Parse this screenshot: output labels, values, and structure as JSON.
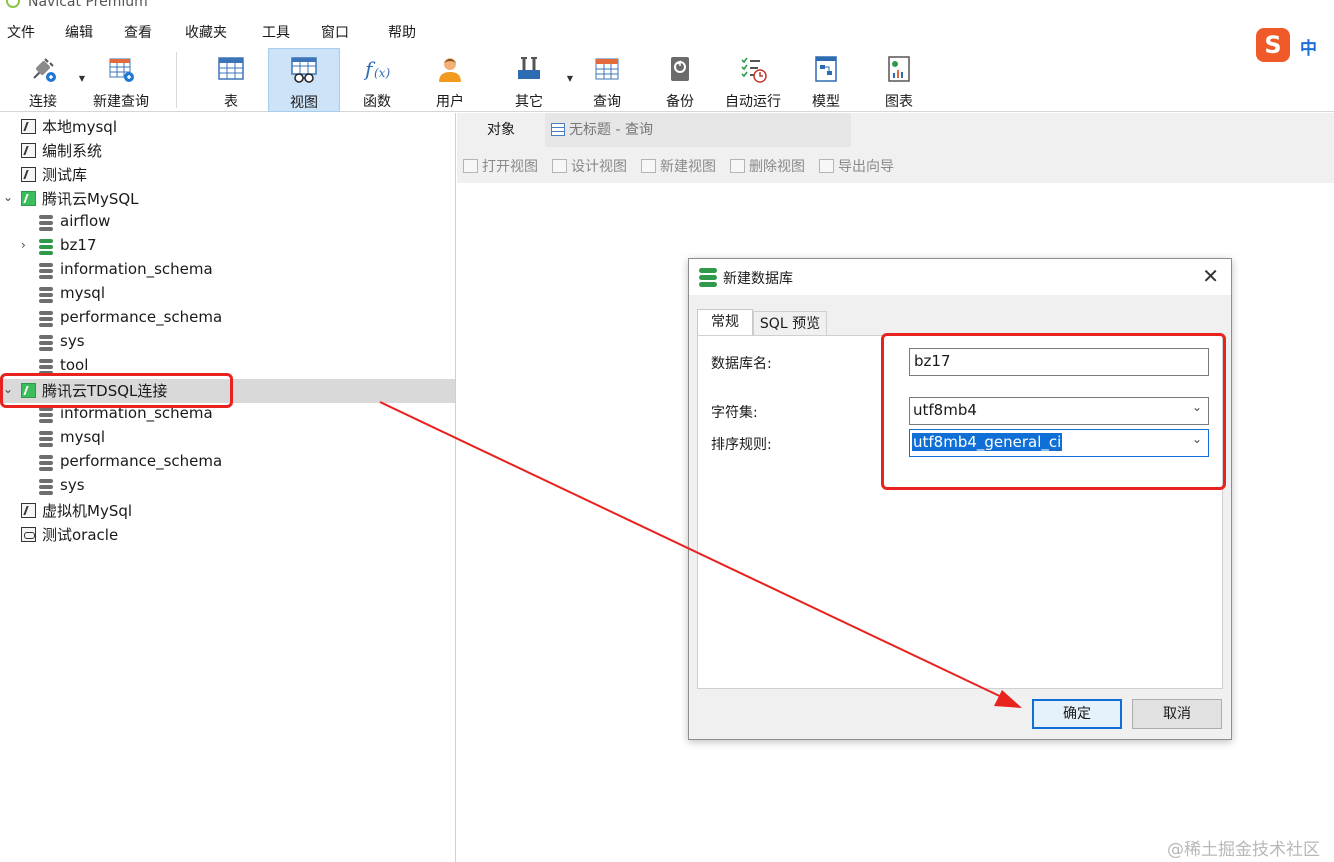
{
  "app": {
    "title": "Navicat Premium"
  },
  "menu": [
    "文件",
    "编辑",
    "查看",
    "收藏夹",
    "工具",
    "窗口",
    "帮助"
  ],
  "ime": {
    "logo": "S",
    "mode": "中"
  },
  "toolbar": {
    "connect": "连接",
    "new_query": "新建查询",
    "table": "表",
    "view": "视图",
    "function": "函数",
    "user": "用户",
    "other": "其它",
    "query": "查询",
    "backup": "备份",
    "auto_run": "自动运行",
    "model": "模型",
    "chart": "图表"
  },
  "tree": [
    {
      "label": "本地mysql",
      "kind": "connection"
    },
    {
      "label": "编制系统",
      "kind": "connection"
    },
    {
      "label": "测试库",
      "kind": "connection"
    },
    {
      "label": "腾讯云MySQL",
      "kind": "connection-open"
    },
    {
      "label": "airflow",
      "kind": "database"
    },
    {
      "label": "bz17",
      "kind": "database-open"
    },
    {
      "label": "information_schema",
      "kind": "database"
    },
    {
      "label": "mysql",
      "kind": "database"
    },
    {
      "label": "performance_schema",
      "kind": "database"
    },
    {
      "label": "sys",
      "kind": "database"
    },
    {
      "label": "tool",
      "kind": "database"
    },
    {
      "label": "腾讯云TDSQL连接",
      "kind": "connection-open",
      "selected": true
    },
    {
      "label": "information_schema",
      "kind": "database"
    },
    {
      "label": "mysql",
      "kind": "database"
    },
    {
      "label": "performance_schema",
      "kind": "database"
    },
    {
      "label": "sys",
      "kind": "database"
    },
    {
      "label": "虚拟机MySql",
      "kind": "connection"
    },
    {
      "label": "测试oracle",
      "kind": "oracle"
    }
  ],
  "tabs": {
    "objects": "对象",
    "query_tab": "无标题 - 查询"
  },
  "object_bar": [
    "打开视图",
    "设计视图",
    "新建视图",
    "删除视图",
    "导出向导"
  ],
  "dialog": {
    "title": "新建数据库",
    "tab_general": "常规",
    "tab_sql": "SQL 预览",
    "db_name_label": "数据库名:",
    "db_name_value": "bz17",
    "charset_label": "字符集:",
    "charset_value": "utf8mb4",
    "collation_label": "排序规则:",
    "collation_value": "utf8mb4_general_ci",
    "ok": "确定",
    "cancel": "取消"
  },
  "annotation_color": "#e8231f",
  "watermark": "@稀土掘金技术社区"
}
